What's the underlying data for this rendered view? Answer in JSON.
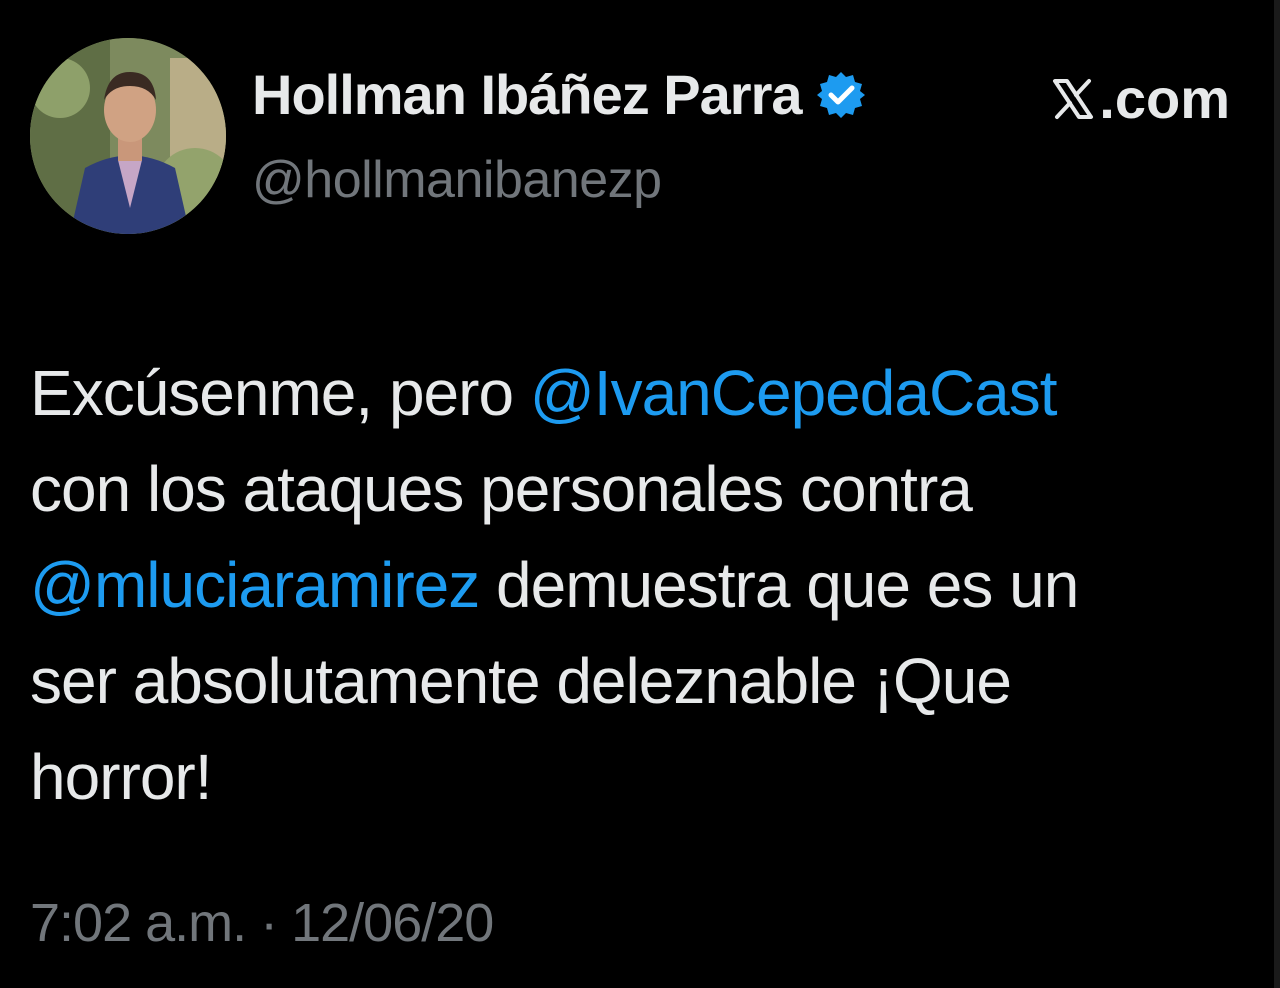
{
  "author": {
    "display_name": "Hollman Ibáñez Parra",
    "handle": "@hollmanibanezp",
    "verified": true,
    "verified_color": "#1d9bf0"
  },
  "brand": {
    "label": ".com",
    "logo_icon": "x-logo-icon"
  },
  "tweet": {
    "segments": {
      "l1_text": "Excúsenme, pero ",
      "l1_mention": "@IvanCepedaCast",
      "l2_text": "con los ataques personales contra",
      "l3_mention": "@mluciaramirez",
      "l3_text": " demuestra que es un",
      "l4_text": "ser absolutamente deleznable ¡Que",
      "l5_text": "horror!"
    },
    "mention_color": "#1d9bf0",
    "text_color": "#e7e9ea"
  },
  "timestamp": "7:02 a.m. · 12/06/20",
  "colors": {
    "background": "#000000",
    "secondary_text": "#71767b"
  }
}
